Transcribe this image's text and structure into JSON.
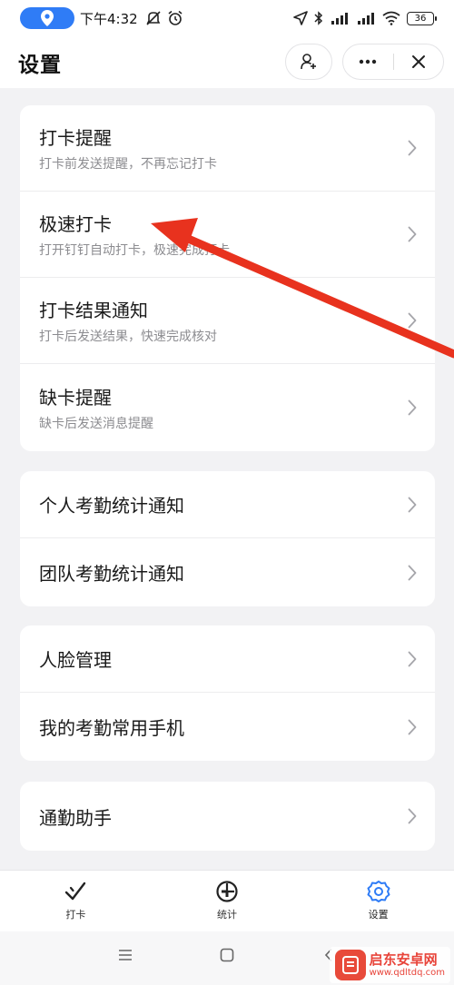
{
  "status_bar": {
    "time": "下午4:32",
    "battery": "36"
  },
  "header": {
    "title": "设置"
  },
  "sections": [
    {
      "items": [
        {
          "label": "打卡提醒",
          "sub": "打卡前发送提醒，不再忘记打卡"
        },
        {
          "label": "极速打卡",
          "sub": "打开钉钉自动打卡，极速完成打卡"
        },
        {
          "label": "打卡结果通知",
          "sub": "打卡后发送结果，快速完成核对"
        },
        {
          "label": "缺卡提醒",
          "sub": "缺卡后发送消息提醒"
        }
      ]
    },
    {
      "items": [
        {
          "label": "个人考勤统计通知"
        },
        {
          "label": "团队考勤统计通知"
        }
      ]
    },
    {
      "items": [
        {
          "label": "人脸管理"
        },
        {
          "label": "我的考勤常用手机"
        }
      ]
    },
    {
      "items": [
        {
          "label": "通勤助手"
        }
      ]
    }
  ],
  "bottom_nav": {
    "tabs": [
      {
        "label": "打卡",
        "icon": "check-icon"
      },
      {
        "label": "统计",
        "icon": "pie-chart-icon"
      },
      {
        "label": "设置",
        "icon": "gear-icon",
        "active": true
      }
    ]
  },
  "watermark": {
    "name": "启东安卓网",
    "url": "www.qdltdq.com"
  },
  "colors": {
    "accent": "#2f7cf6",
    "arrow": "#e8321e",
    "background": "#f2f2f4"
  }
}
